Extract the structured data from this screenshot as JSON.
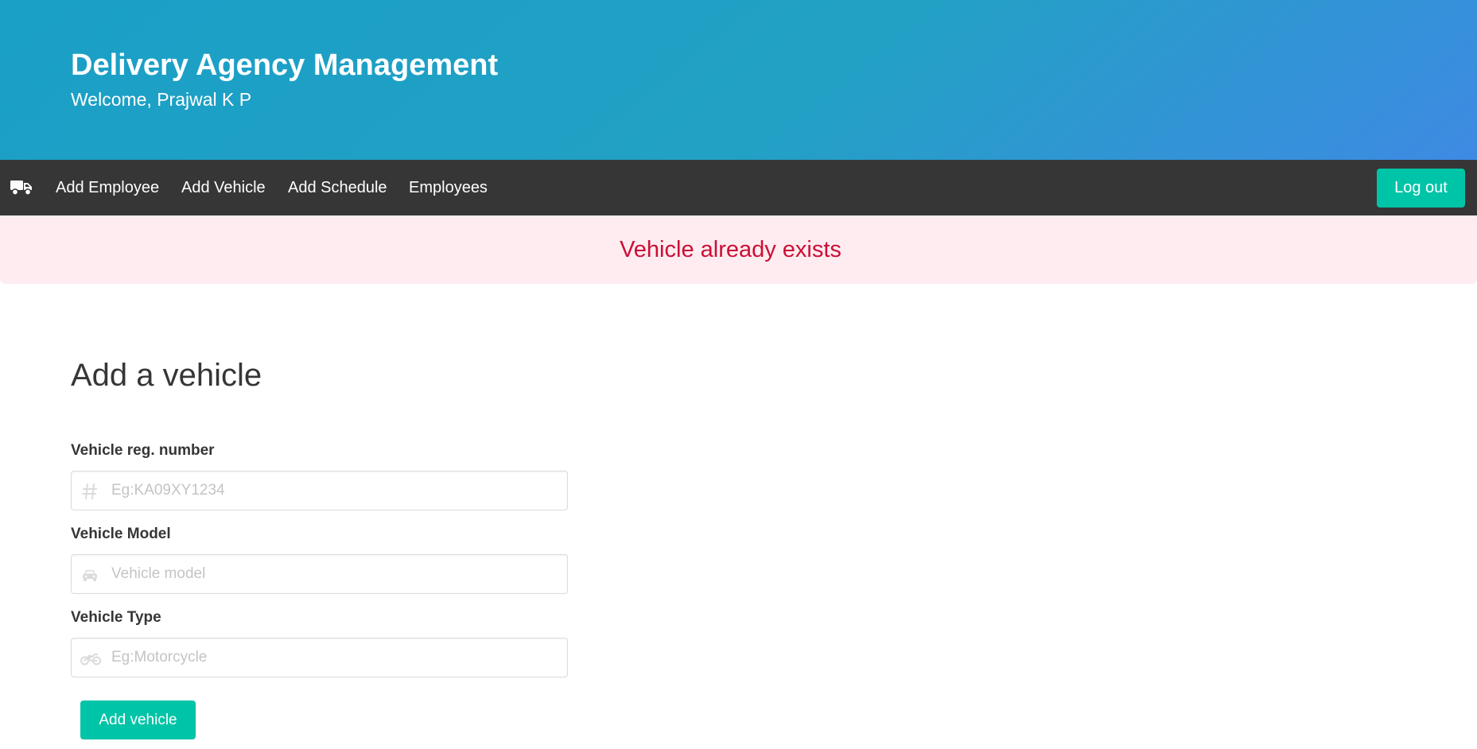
{
  "header": {
    "title": "Delivery Agency Management",
    "welcome": "Welcome, Prajwal K P"
  },
  "navbar": {
    "brand_icon": "truck-icon",
    "items": [
      {
        "label": "Add Employee"
      },
      {
        "label": "Add Vehicle"
      },
      {
        "label": "Add Schedule"
      },
      {
        "label": "Employees"
      }
    ],
    "logout_label": "Log out"
  },
  "notification": {
    "message": "Vehicle already exists"
  },
  "form": {
    "heading": "Add a vehicle",
    "fields": [
      {
        "label": "Vehicle reg. number",
        "placeholder": "Eg:KA09XY1234",
        "value": "",
        "icon": "hash-icon"
      },
      {
        "label": "Vehicle Model",
        "placeholder": "Vehicle model",
        "value": "",
        "icon": "car-icon"
      },
      {
        "label": "Vehicle Type",
        "placeholder": "Eg:Motorcycle",
        "value": "",
        "icon": "motorcycle-icon"
      }
    ],
    "submit_label": "Add vehicle"
  },
  "colors": {
    "hero_gradient_start": "#1a9fc7",
    "hero_gradient_end": "#3e8ae3",
    "navbar_bg": "#363636",
    "accent": "#00c4a7",
    "danger_bg": "#feecf0",
    "danger_text": "#cc0f35"
  }
}
